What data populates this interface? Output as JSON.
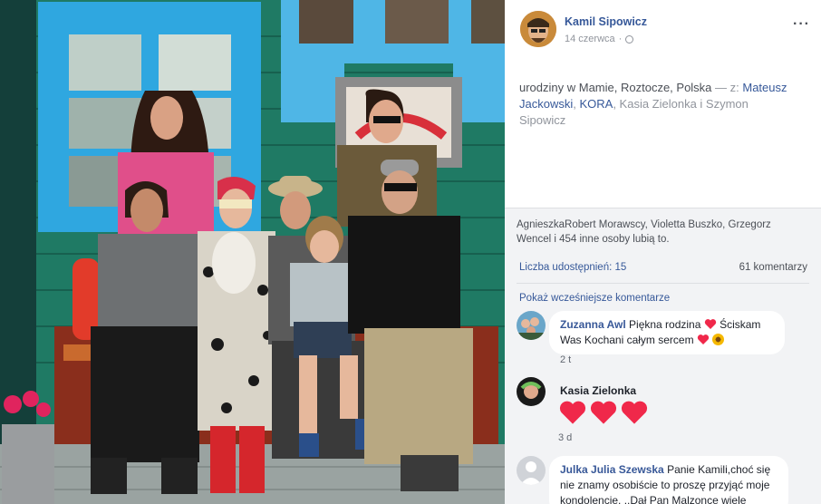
{
  "post": {
    "author": "Kamil Sipowicz",
    "date": "14 czerwca",
    "more_label": "···",
    "text_prefix": "urodziny w Mamie, Roztocze, Polska",
    "text_with": " — z: ",
    "tag_mateusz": "Mateusz Jackowski",
    "tag_sep1": ", ",
    "tag_kora": "KORA",
    "text_rest": ", Kasia Zielonka i Szymon Sipowicz"
  },
  "reactions": {
    "likes_text": "AgnieszkaRobert Morawscy, Violetta Buszko, Grzegorz Wencel i 454 inne osoby lubią to.",
    "shares": "Liczba udostępnień: 15",
    "comments_count": "61 komentarzy",
    "prev_comments": "Pokaż wcześniejsze komentarze"
  },
  "comments": [
    {
      "name": "Zuzanna Awl",
      "text1": " Piękna rodzina ",
      "text2": " Ściskam Was Kochani całym sercem ",
      "time": "2 t"
    },
    {
      "name": "Kasia Zielonka",
      "text1": "",
      "text2": "",
      "time": "3 d"
    },
    {
      "name": "Julka Julia Szewska",
      "text1": " Panie Kamili,choć się nie znamy osobiście to proszę przyjąć moje kondolencje. ..Dał Pan Malzonce wiele",
      "text2": "",
      "time": ""
    }
  ],
  "colors": {
    "link": "#365899",
    "heart": "#f0284a",
    "wall_green": "#1f7a64",
    "window_blue": "#2fa7e0"
  },
  "icons": [
    "globe-icon",
    "more-options-icon",
    "heart-icon",
    "sunflower-icon"
  ]
}
